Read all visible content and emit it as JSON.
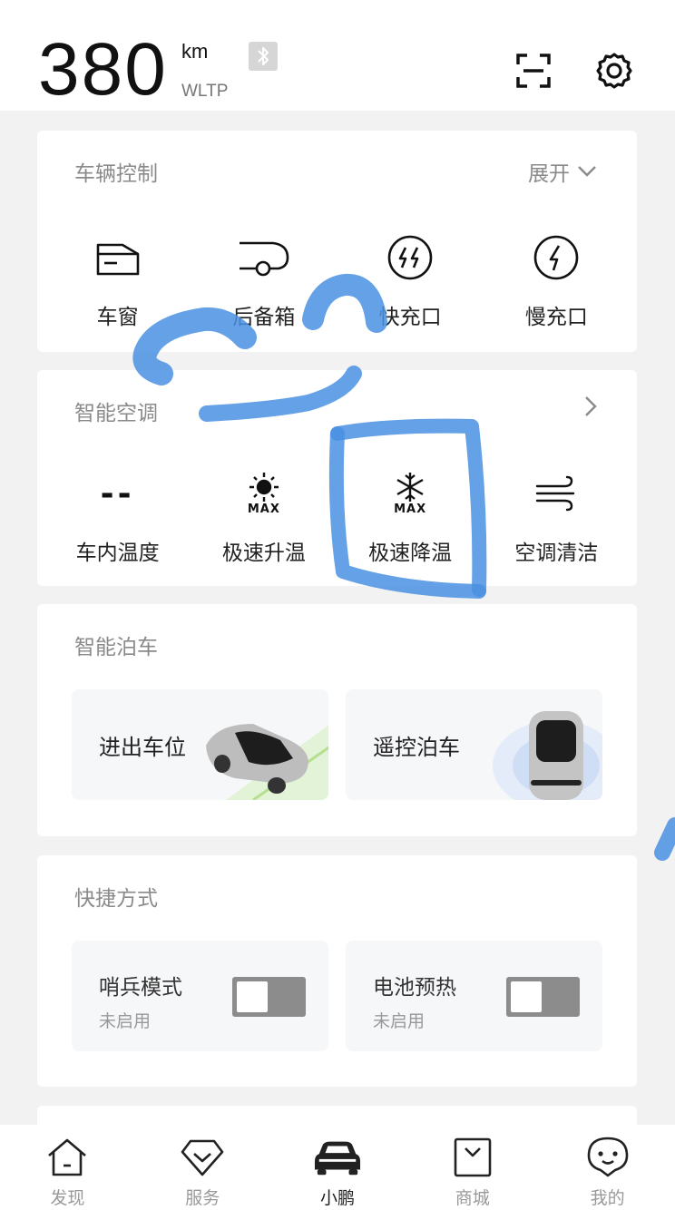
{
  "header": {
    "range_value": "380",
    "range_unit": "km",
    "range_standard": "WLTP",
    "icons": [
      "bluetooth-icon",
      "scan-icon",
      "settings-icon"
    ]
  },
  "vehicle_control": {
    "title": "车辆控制",
    "expand_label": "展开",
    "items": [
      {
        "label": "车窗",
        "icon": "window-icon"
      },
      {
        "label": "后备箱",
        "icon": "trunk-icon"
      },
      {
        "label": "快充口",
        "icon": "fast-charge-icon"
      },
      {
        "label": "慢充口",
        "icon": "slow-charge-icon"
      }
    ]
  },
  "climate": {
    "title": "智能空调",
    "items": [
      {
        "label": "车内温度",
        "value": "--",
        "icon": "temperature-placeholder"
      },
      {
        "label": "极速升温",
        "icon": "max-heat-icon",
        "badge": "MAX"
      },
      {
        "label": "极速降温",
        "icon": "max-cool-icon",
        "badge": "MAX"
      },
      {
        "label": "空调清洁",
        "icon": "ac-clean-icon"
      }
    ]
  },
  "parking": {
    "title": "智能泊车",
    "tiles": [
      {
        "label": "进出车位"
      },
      {
        "label": "遥控泊车"
      }
    ]
  },
  "shortcuts": {
    "title": "快捷方式",
    "items": [
      {
        "name": "哨兵模式",
        "status": "未启用",
        "on": false
      },
      {
        "name": "电池预热",
        "status": "未启用",
        "on": false
      }
    ]
  },
  "nav": {
    "items": [
      {
        "label": "发现",
        "icon": "home-icon",
        "active": false
      },
      {
        "label": "服务",
        "icon": "service-icon",
        "active": false
      },
      {
        "label": "小鹏",
        "icon": "car-icon",
        "active": true
      },
      {
        "label": "商城",
        "icon": "shop-icon",
        "active": false
      },
      {
        "label": "我的",
        "icon": "profile-icon",
        "active": false
      }
    ]
  },
  "colors": {
    "annotation_blue": "#4a90e2",
    "toggle_off": "#8c8c8c"
  }
}
